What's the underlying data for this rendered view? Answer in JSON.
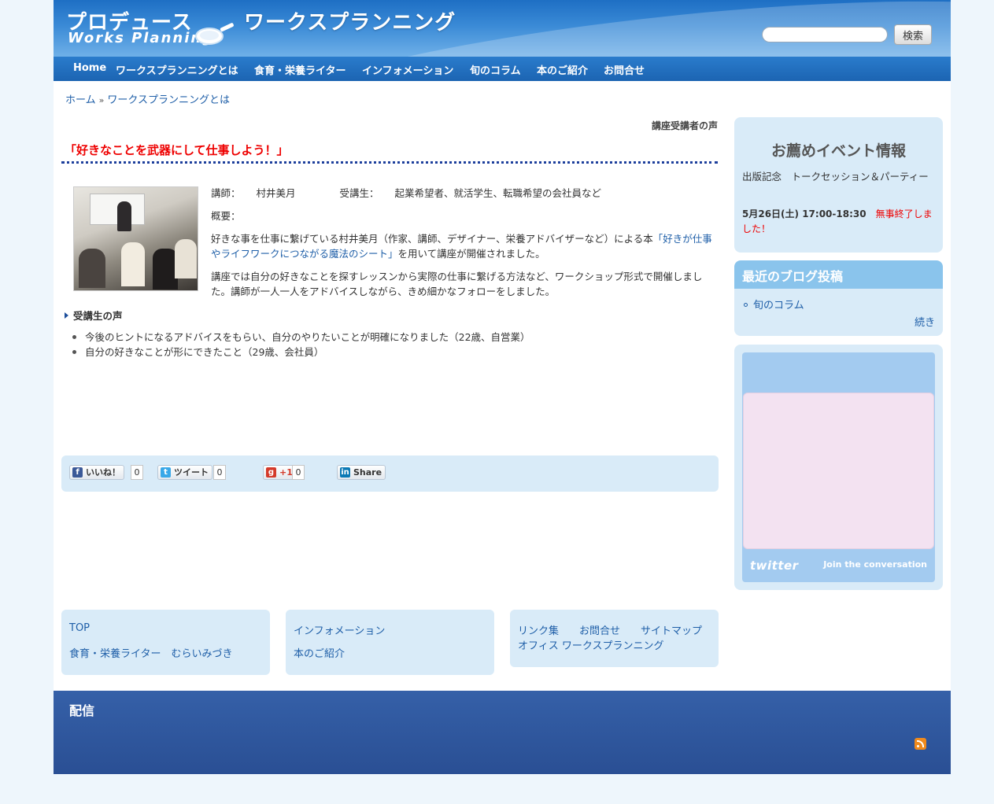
{
  "header": {
    "logo_top": "プロデュース",
    "logo_bottom": "Works Planning",
    "site_title": "ワークスプランニング",
    "search_placeholder": "",
    "search_button": "検索"
  },
  "nav": {
    "items": [
      "Home",
      "ワークスプランニングとは",
      "食育・栄養ライター",
      "インフォメーション",
      "旬のコラム",
      "本のご紹介",
      "お問合せ"
    ]
  },
  "breadcrumb": {
    "home": "ホーム",
    "separator": "»",
    "current": "ワークスプランニングとは"
  },
  "article": {
    "category": "講座受講者の声",
    "title": "「好きなことを武器にして仕事しよう！」",
    "instructor_label": "講師：",
    "instructor_name": "村井美月",
    "students_label": "受講生：",
    "students_value": "起業希望者、就活学生、転職希望の会社員など",
    "overview_label": "概要：",
    "para1_before": "好きな事を仕事に繋げている村井美月（作家、講師、デザイナー、栄養アドバイザーなど）による本",
    "para1_link": "「好きが仕事やライフワークにつながる魔法のシート」",
    "para1_after": "を用いて講座が開催されました。",
    "para2": "講座では自分の好きなことを探すレッスンから実際の仕事に繋げる方法など、ワークショップ形式で開催しました。講師が一人一人をアドバイスしながら、きめ細かなフォローをしました。",
    "voices_heading": "受講生の声",
    "voices": [
      "今後のヒントになるアドバイスをもらい、自分のやりたいことが明確になりました（22歳、自営業）",
      "自分の好きなことが形にできたこと（29歳、会社員）"
    ]
  },
  "share": {
    "like_label": "いいね！",
    "like_count": "0",
    "tweet_label": "ツイート",
    "tweet_count": "0",
    "gplus_label": "+1",
    "gplus_count": "0",
    "linkedin_label": "Share"
  },
  "sidebar": {
    "events_title": "お薦めイベント情報",
    "event_name": "出版記念　トークセッション＆パーティー",
    "event_date": "5月26日(土) 17:00-18:30",
    "event_status": "無事終了しました！",
    "blog_title": "最近のブログ投稿",
    "blog_item": "旬のコラム",
    "blog_more": "続き",
    "twitter_logo": "twitter",
    "twitter_join": "Join the conversation"
  },
  "footer_links": {
    "box1": [
      "TOP",
      "食育・栄養ライター　むらいみづき"
    ],
    "box2": [
      "インフォメーション",
      "本のご紹介"
    ],
    "box3": [
      "リンク集",
      "お問合せ",
      "サイトマップ",
      "オフィス ワークスプランニング"
    ]
  },
  "bottom": {
    "feed_title": "配信"
  },
  "colors": {
    "header_blue": "#1e6fc4",
    "title_red": "#e00000",
    "link_blue": "#1f5fa8",
    "panel_bg": "#d9ebf8",
    "footer_band": "#2f58a0"
  }
}
